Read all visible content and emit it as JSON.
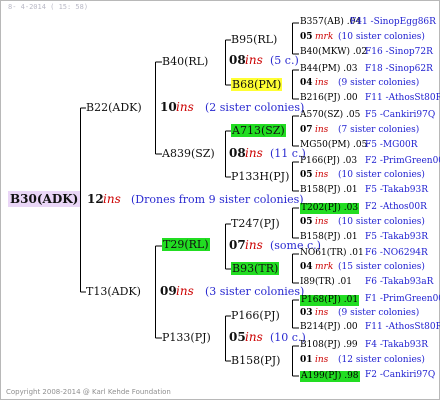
{
  "header": {
    "date": "8- 4-2014 ( 15: 58)"
  },
  "footer": {
    "copyright": "Copyright 2008-2014 @ Karl Kehde Foundation"
  },
  "root": {
    "name": "B30(ADK)",
    "num": "12",
    "mark": "ins",
    "note": "(Drones from 9 sister colonies)"
  },
  "gen1": [
    {
      "name": "B22(ADK)",
      "num": "10",
      "mark": "ins",
      "note": "(2 sister colonies)"
    },
    {
      "name": "T13(ADK)",
      "num": "09",
      "mark": "ins",
      "note": "(3 sister colonies)"
    }
  ],
  "gen2": [
    {
      "name": "B40(RL)"
    },
    {
      "name": "A839(SZ)",
      "num": "08",
      "mark": "ins",
      "note": "(11 c.)"
    },
    {
      "name": "T29(RL)",
      "num": "07",
      "mark": "ins",
      "note": "(some c.)"
    },
    {
      "name": "P133(PJ)",
      "num": "05",
      "mark": "ins",
      "note": "(10 c.)"
    }
  ],
  "gen3": [
    {
      "name": "B95(RL)",
      "num": "08",
      "mark": "ins",
      "note": "(5 c.)"
    },
    {
      "name": "B68(PM)"
    },
    {
      "name": "A713(SZ)"
    },
    {
      "name": "P133H(PJ)"
    },
    {
      "name": "T247(PJ)"
    },
    {
      "name": "B93(TR)"
    },
    {
      "name": "P166(PJ)"
    },
    {
      "name": "B158(PJ)"
    }
  ],
  "gen4": [
    {
      "left": "B357(AB) .04",
      "right": "F41 -SinopEgg86R"
    },
    {
      "num": "05",
      "mark": "mrk",
      "note": "(10 sister colonies)"
    },
    {
      "left": "B40(MKW) .02",
      "right": "F16 -Sinop72R"
    },
    {
      "left": "B44(PM) .03",
      "right": "F18 -Sinop62R"
    },
    {
      "num": "04",
      "mark": "ins",
      "note": "(9 sister colonies)"
    },
    {
      "left": "B216(PJ) .00",
      "right": "F11 -AthosSt80R"
    },
    {
      "left": "A570(SZ) .05",
      "right": "F5 -Cankiri97Q"
    },
    {
      "num": "07",
      "mark": "ins",
      "note": "(7 sister colonies)"
    },
    {
      "left": "MG50(PM) .05",
      "right": "F5 -MG00R"
    },
    {
      "left": "P166(PJ) .03",
      "right": "F2 -PrimGreen00"
    },
    {
      "num": "05",
      "mark": "ins",
      "note": "(10 sister colonies)"
    },
    {
      "left": "B158(PJ) .01",
      "right": "F5 -Takab93R"
    },
    {
      "left": "T202(PJ) .03",
      "right": "F2 -Athos00R"
    },
    {
      "num": "05",
      "mark": "ins",
      "note": "(10 sister colonies)"
    },
    {
      "left": "B158(PJ) .01",
      "right": "F5 -Takab93R"
    },
    {
      "left": "NO61(TR) .01",
      "right": "F6 -NO6294R"
    },
    {
      "num": "04",
      "mark": "mrk",
      "note": "(15 sister colonies)"
    },
    {
      "left": "I89(TR) .01",
      "right": "F6 -Takab93aR"
    },
    {
      "left": "P168(PJ) .01",
      "right": "F1 -PrimGreen00"
    },
    {
      "num": "03",
      "mark": "ins",
      "note": "(9 sister colonies)"
    },
    {
      "left": "B214(PJ) .00",
      "right": "F11 -AthosSt80R"
    },
    {
      "left": "B108(PJ) .99",
      "right": "F4 -Takab93R"
    },
    {
      "num": "01",
      "mark": "ins",
      "note": "(12 sister colonies)"
    },
    {
      "left": "A199(PJ) .98",
      "right": "F2 -Cankiri97Q"
    }
  ]
}
